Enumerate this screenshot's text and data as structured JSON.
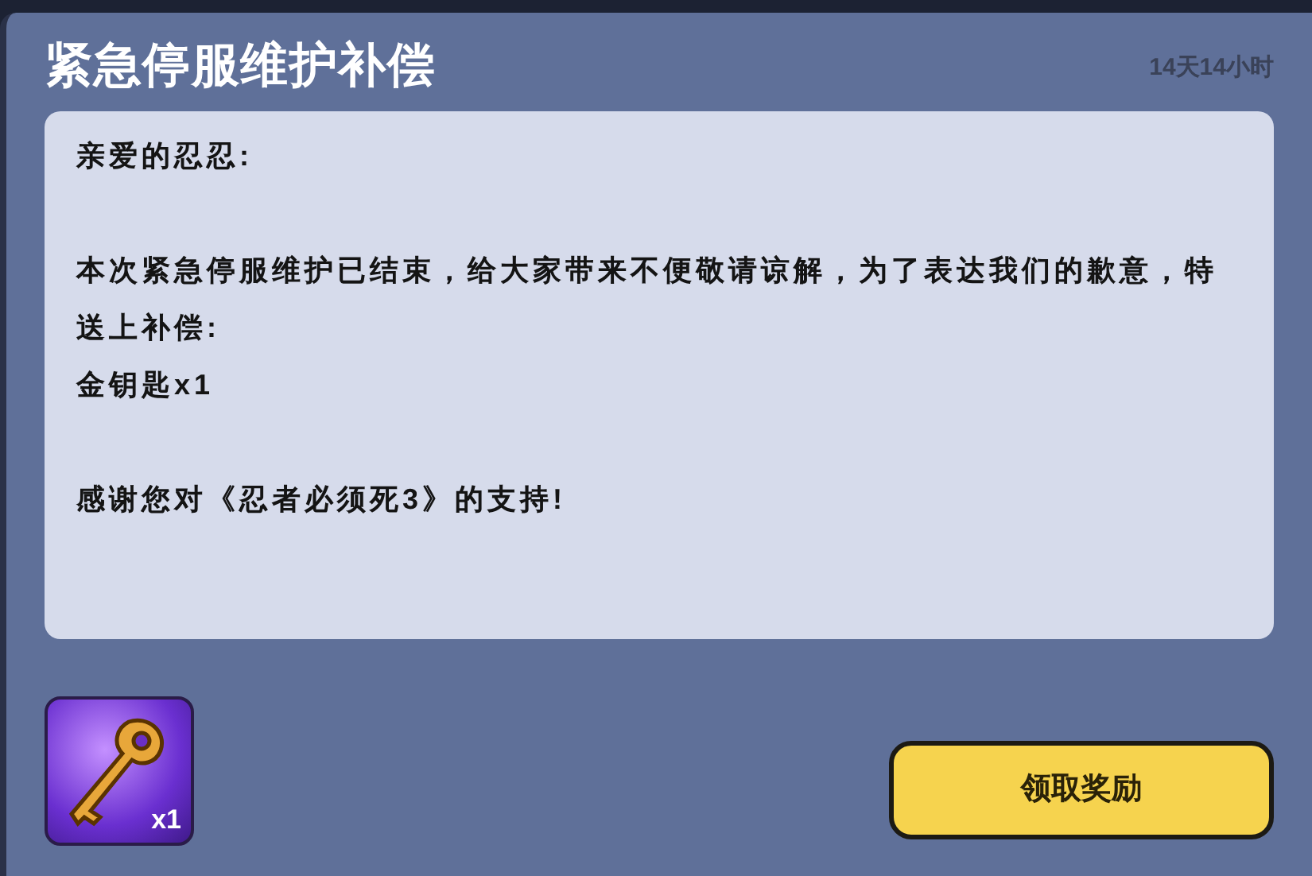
{
  "mail": {
    "title": "紧急停服维护补偿",
    "expires": "14天14小时",
    "paragraphs": [
      [
        "亲爱的忍忍:"
      ],
      [
        "本次紧急停服维护已结束，给大家带来不便敬请谅解，为了表达我们的歉意，特送上补偿:",
        "金钥匙x1"
      ],
      [
        "感谢您对《忍者必须死3》的支持!"
      ]
    ],
    "rewards": [
      {
        "kind": "key",
        "count": "x1"
      }
    ],
    "claim_button": "领取奖励"
  }
}
